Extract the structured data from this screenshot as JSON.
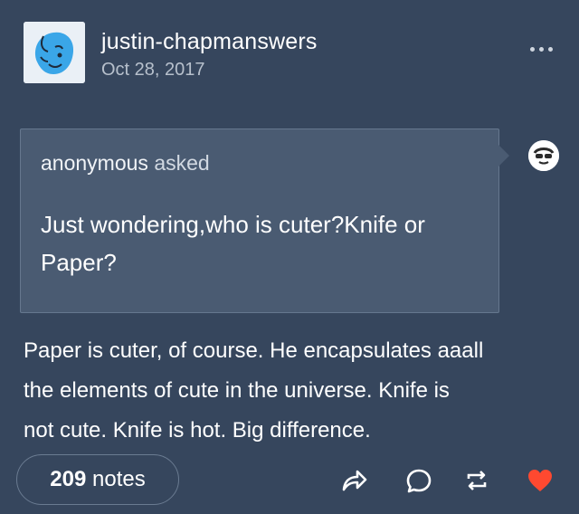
{
  "post": {
    "author": "justin-chapmanswers",
    "date": "Oct 28, 2017",
    "asker": "anonymous",
    "asked_label": "asked",
    "question_line1": "Just wondering,who is cuter?Knife or",
    "question_line2": "Paper?",
    "answer_line1": "Paper is cuter, of course. He encapsulates aaall",
    "answer_line2": "the elements of cute in the universe. Knife is",
    "answer_line3": "not cute. Knife is hot. Big difference."
  },
  "footer": {
    "notes_count": "209",
    "notes_label": "notes",
    "icons": [
      "share-icon",
      "reply-icon",
      "reblog-icon",
      "like-icon"
    ]
  },
  "colors": {
    "background": "#36465d",
    "ask_box": "#4a5b72",
    "like": "#ff4930"
  }
}
